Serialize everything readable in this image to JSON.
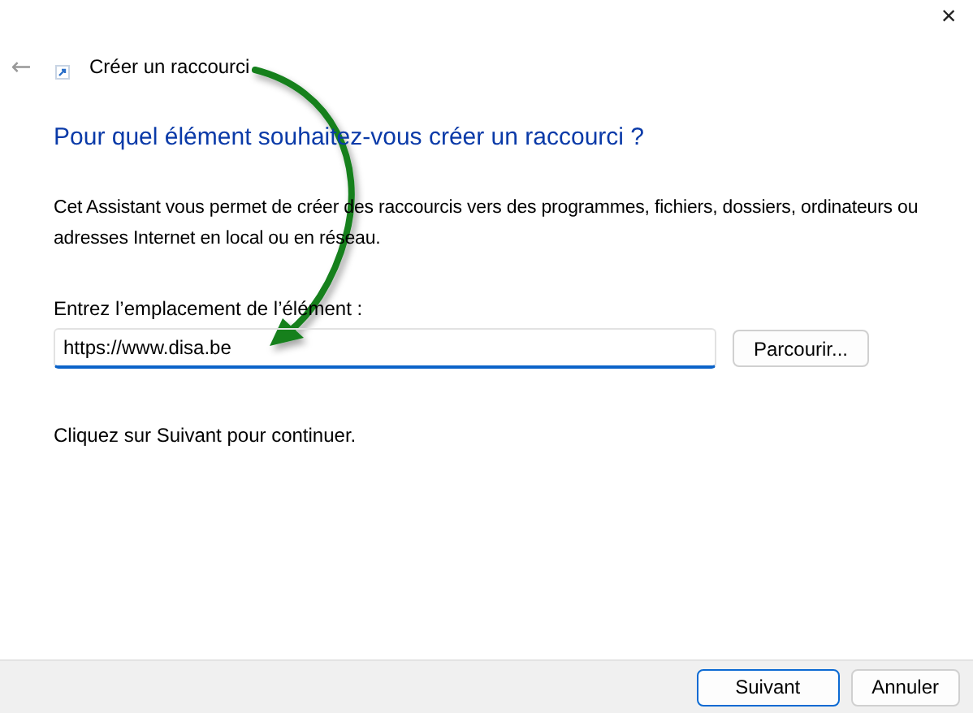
{
  "window": {
    "close": "×",
    "back": "←",
    "title": "Créer un raccourci"
  },
  "heading": "Pour quel élément souhaitez-vous créer un raccourci ?",
  "description": "Cet Assistant vous permet de créer des raccourcis vers des programmes, fichiers, dossiers, ordinateurs ou adresses Internet en local ou en réseau.",
  "location": {
    "label": "Entrez l’emplacement de l’élément :",
    "value": "https://www.disa.be",
    "browse": "Parcourir..."
  },
  "hint": "Cliquez sur Suivant pour continuer.",
  "buttons": [
    {
      "label": "Suivant",
      "selected": true
    },
    {
      "label": "Annuler",
      "selected": false
    }
  ]
}
